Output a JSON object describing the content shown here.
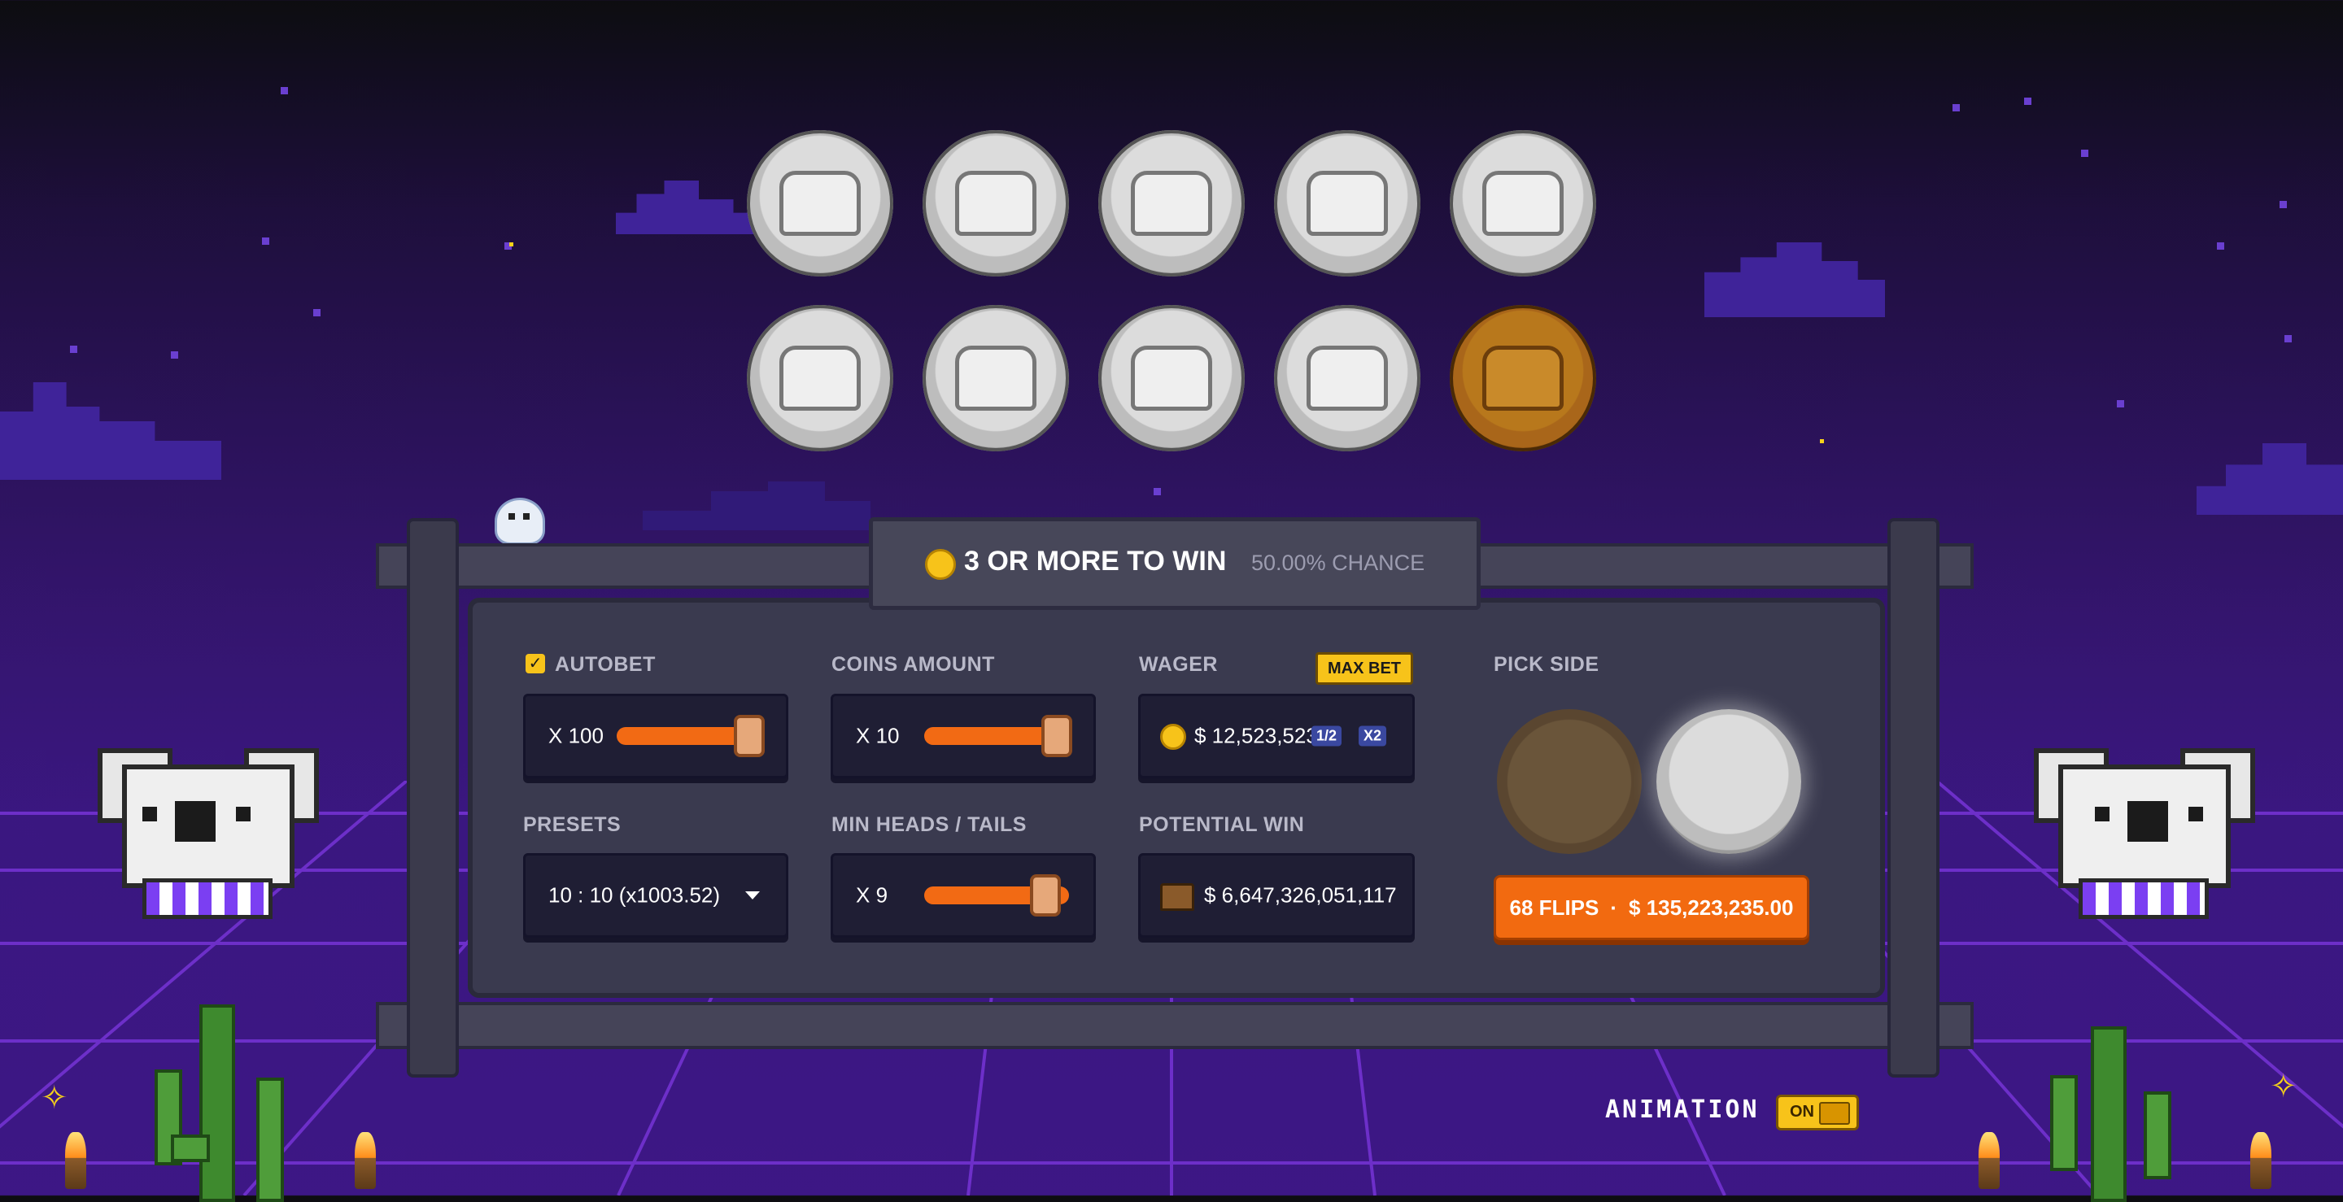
{
  "banner": {
    "title": "3 OR MORE TO WIN",
    "chance": "50.00% CHANCE"
  },
  "controls": {
    "autobet": {
      "label": "AUTOBET",
      "checked": true,
      "value": "X 100",
      "slider_fraction": 1.0
    },
    "coins_amount": {
      "label": "COINS AMOUNT",
      "value": "X 10",
      "slider_fraction": 1.0
    },
    "wager": {
      "label": "WAGER",
      "max_bet_label": "MAX BET",
      "value": "$ 12,523,523",
      "half_label": "1/2",
      "double_label": "X2"
    },
    "presets": {
      "label": "PRESETS",
      "value": "10 : 10 (x1003.52)"
    },
    "min_heads_tails": {
      "label": "MIN HEADS / TAILS",
      "value": "X 9",
      "slider_fraction": 0.9
    },
    "potential_win": {
      "label": "POTENTIAL WIN",
      "value": "$ 6,647,326,051,117"
    },
    "pick_side": {
      "label": "PICK SIDE",
      "selected": "silver"
    },
    "flip_button": {
      "flips": "68 FLIPS",
      "separator": "·",
      "amount": "$ 135,223,235.00"
    }
  },
  "animation": {
    "label": "ANIMATION",
    "toggle_label": "ON",
    "enabled": true
  },
  "coins": [
    {
      "side": "silver"
    },
    {
      "side": "silver"
    },
    {
      "side": "silver"
    },
    {
      "side": "silver"
    },
    {
      "side": "silver"
    },
    {
      "side": "silver"
    },
    {
      "side": "silver"
    },
    {
      "side": "silver"
    },
    {
      "side": "silver"
    },
    {
      "side": "gold"
    }
  ],
  "colors": {
    "accent": "#f26a14",
    "gold": "#f7c31a",
    "panel": "#3a3a4f",
    "field": "#1f1e34",
    "background": "#2a1258"
  }
}
